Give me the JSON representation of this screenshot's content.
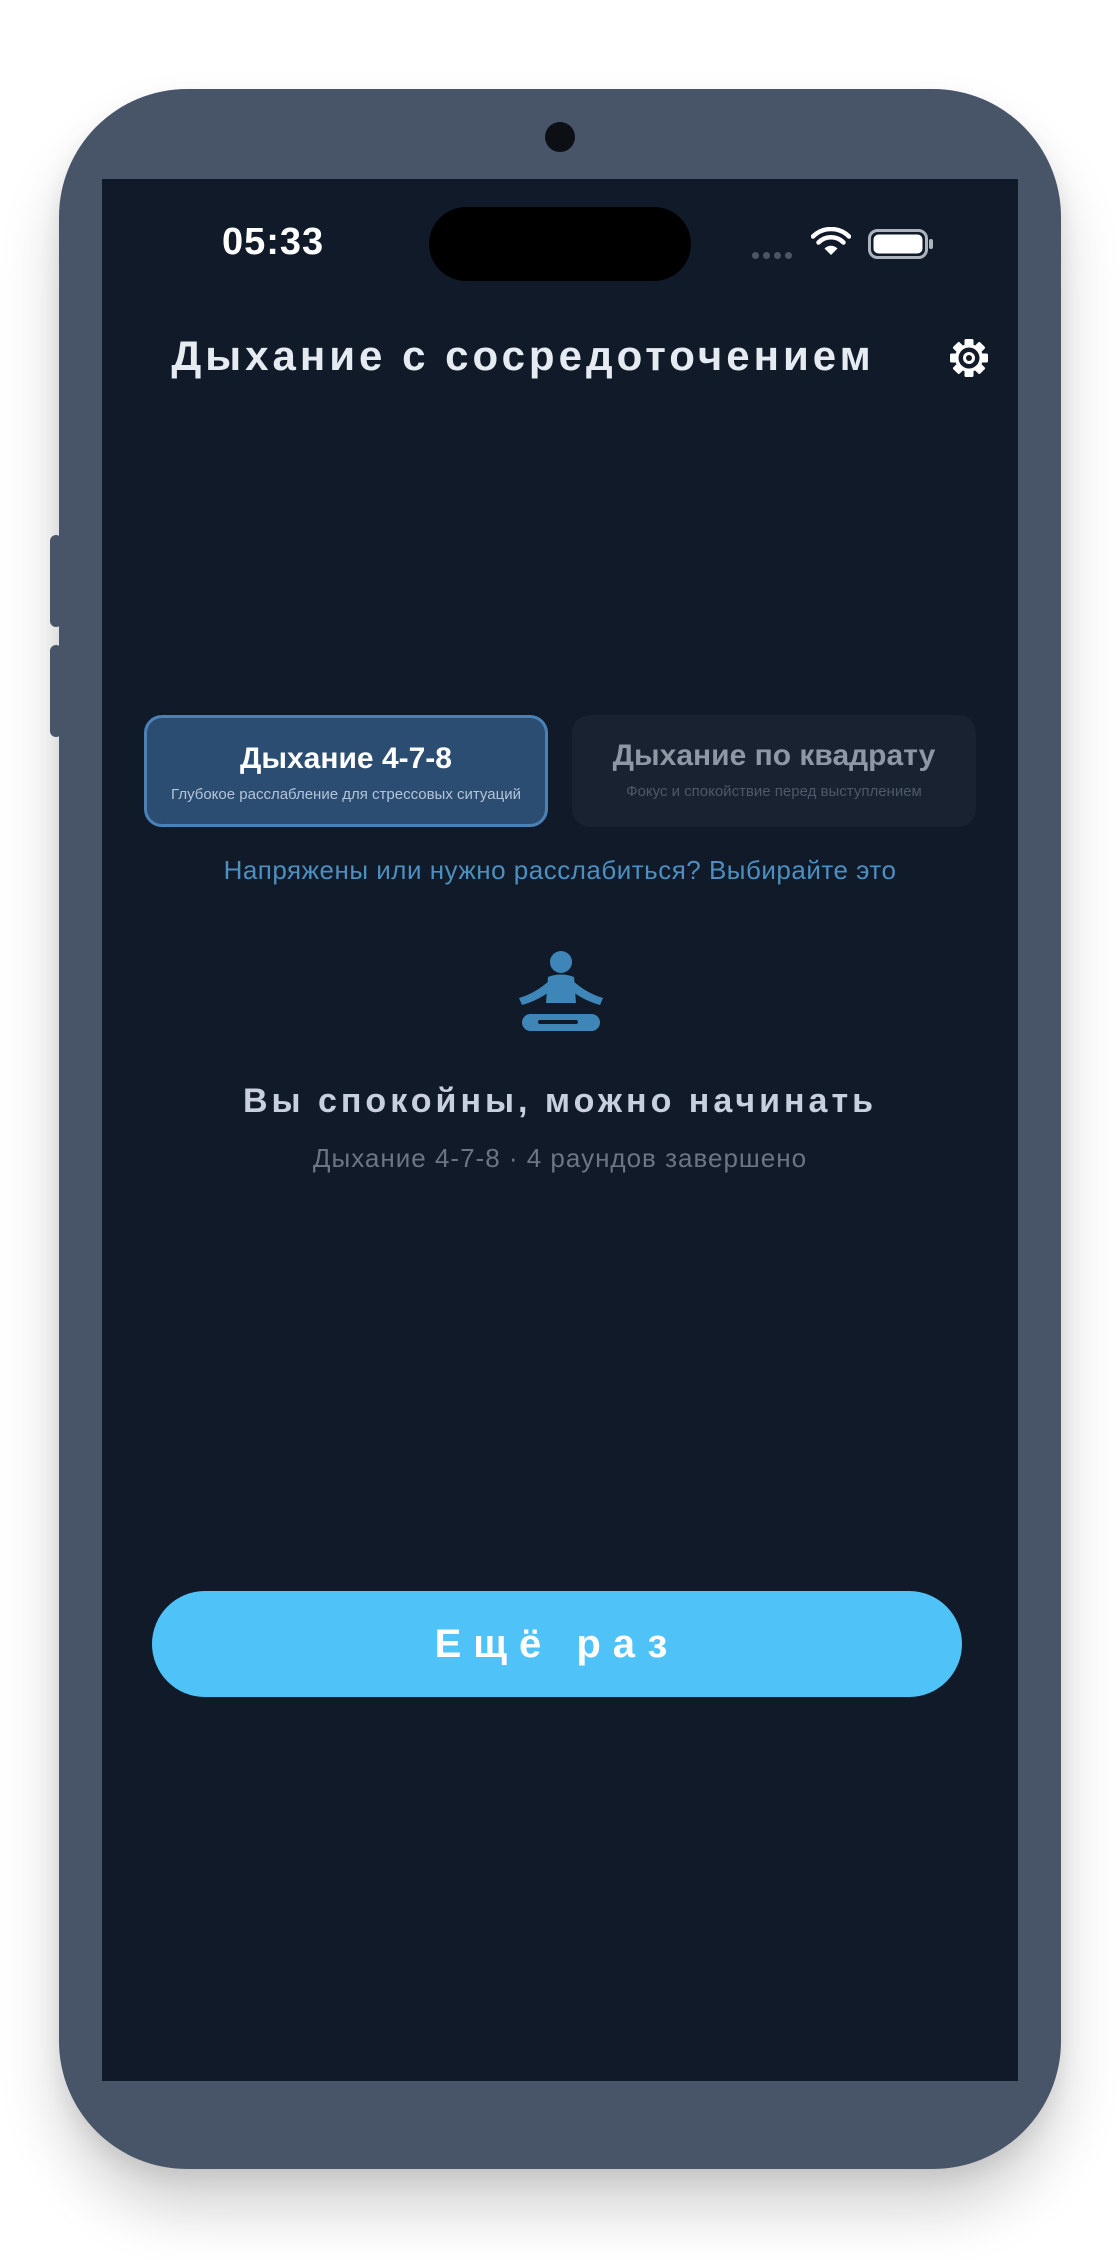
{
  "status_bar": {
    "time": "05:33"
  },
  "header": {
    "title": "Дыхание с сосредоточением",
    "settings_icon": "gear-icon"
  },
  "techniques": [
    {
      "title": "Дыхание 4-7-8",
      "subtitle": "Глубокое расслабление для стрессовых ситуаций",
      "selected": true
    },
    {
      "title": "Дыхание по квадрату",
      "subtitle": "Фокус и спокойствие перед выступлением",
      "selected": false
    }
  ],
  "hint": "Напряжены или нужно расслабиться? Выбирайте это",
  "session": {
    "icon": "meditation-icon",
    "title": "Вы спокойны, можно начинать",
    "subtitle": "Дыхание 4-7-8 · 4 раундов завершено"
  },
  "primary_button": {
    "label": "Ещё раз"
  },
  "colors": {
    "screen_background": "#101a29",
    "accent": "#4fc3f7",
    "selected_tab": "#2c4d72",
    "hint_text": "#4c8fc0"
  }
}
